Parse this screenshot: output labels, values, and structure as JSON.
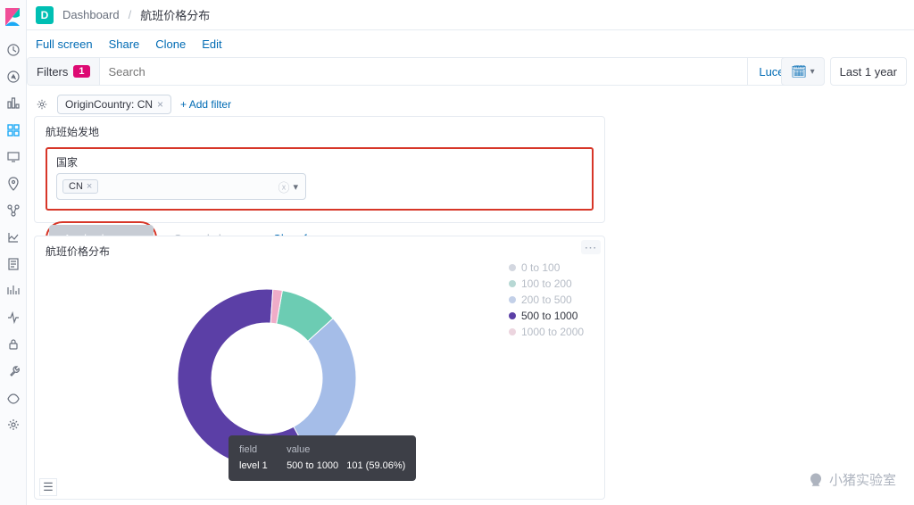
{
  "breadcrumb": {
    "root": "Dashboard",
    "current": "航班价格分布",
    "badge_letter": "D"
  },
  "menubar": {
    "fullscreen": "Full screen",
    "share": "Share",
    "clone": "Clone",
    "edit": "Edit"
  },
  "filterbar": {
    "label": "Filters",
    "count": "1",
    "search_placeholder": "Search",
    "lucene": "Lucene"
  },
  "date": {
    "range": "Last 1 year"
  },
  "pills": {
    "filter0": "OriginCountry: CN",
    "add": "+ Add filter"
  },
  "panel1": {
    "title": "航班始发地",
    "country_label": "国家",
    "chip": "CN",
    "apply": "Apply changes",
    "cancel": "Cancel changes",
    "clear": "Clear form"
  },
  "panel2": {
    "title": "航班价格分布"
  },
  "legend": {
    "items": [
      {
        "label": "0 to 100",
        "color": "#d3d7e0",
        "active": false
      },
      {
        "label": "100 to 200",
        "color": "#b7d8d4",
        "active": false
      },
      {
        "label": "200 to 500",
        "color": "#c3d0e8",
        "active": false
      },
      {
        "label": "500 to 1000",
        "color": "#5b3fa6",
        "active": true
      },
      {
        "label": "1000 to 2000",
        "color": "#ecd5df",
        "active": false
      }
    ]
  },
  "tooltip": {
    "h_field": "field",
    "h_value": "value",
    "r_field": "level 1",
    "r_value": "500 to 1000",
    "r_count": "101 (59.06%)"
  },
  "watermark": "小猪实验室",
  "chart_data": {
    "type": "pie",
    "title": "航班价格分布",
    "series": [
      {
        "label": "0 to 100",
        "color": "#d3dae6",
        "value": 0,
        "pct": 0.0
      },
      {
        "label": "100 to 200",
        "color": "#6cccb3",
        "value": 18,
        "pct": 10.5
      },
      {
        "label": "200 to 500",
        "color": "#a5bde8",
        "value": 49,
        "pct": 28.7
      },
      {
        "label": "500 to 1000",
        "color": "#5b3fa6",
        "value": 101,
        "pct": 59.06
      },
      {
        "label": "1000 to 2000",
        "color": "#efacc8",
        "value": 3,
        "pct": 1.7
      }
    ]
  }
}
